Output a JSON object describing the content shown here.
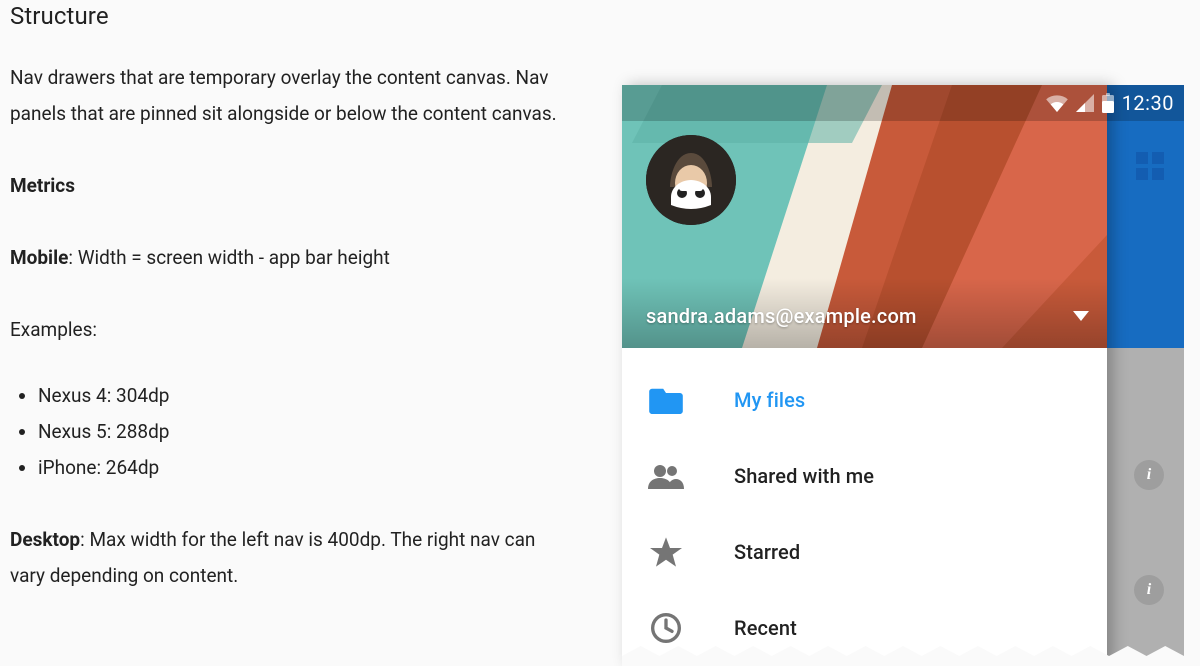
{
  "section": {
    "title": "Structure",
    "intro": "Nav drawers that are temporary overlay the content canvas. Nav panels that are pinned sit alongside or below the content canvas.",
    "metrics_heading": "Metrics",
    "mobile_label": "Mobile",
    "mobile_rule": ": Width = screen width - app bar height",
    "examples_label": "Examples:",
    "examples": [
      "Nexus 4: 304dp",
      "Nexus 5: 288dp",
      "iPhone: 264dp"
    ],
    "desktop_label": "Desktop",
    "desktop_rule": ": Max width for the left nav is 400dp. The right nav can vary depending on content."
  },
  "mock": {
    "statusbar": {
      "time": "12:30"
    },
    "account": {
      "email": "sandra.adams@example.com"
    },
    "nav": [
      {
        "id": "my-files",
        "label": "My files",
        "icon": "folder",
        "active": true
      },
      {
        "id": "shared-with-me",
        "label": "Shared with me",
        "icon": "people",
        "active": false
      },
      {
        "id": "starred",
        "label": "Starred",
        "icon": "star",
        "active": false
      },
      {
        "id": "recent",
        "label": "Recent",
        "icon": "clock",
        "active": false
      }
    ],
    "info_glyph": "i"
  }
}
